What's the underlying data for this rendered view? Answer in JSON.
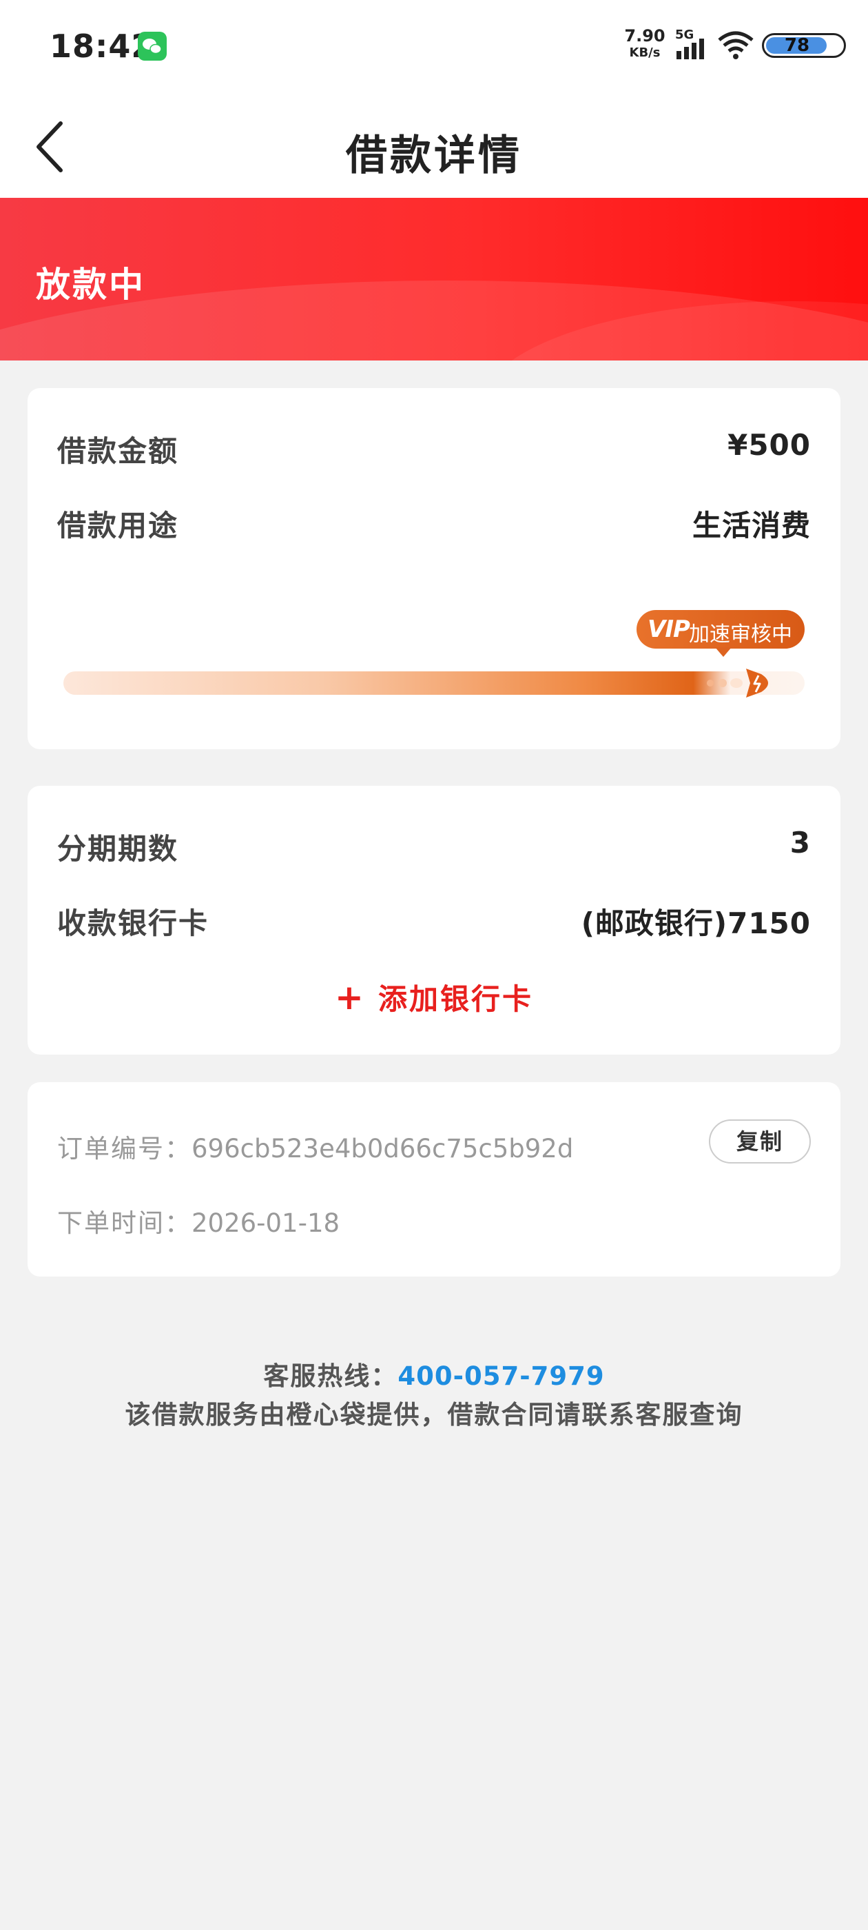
{
  "status_bar": {
    "time": "18:42",
    "net_speed": "7.90",
    "net_speed_unit": "KB/s",
    "network": "5G",
    "battery_level": "78"
  },
  "header": {
    "title": "借款详情"
  },
  "banner": {
    "status": "放款中",
    "color": "#ff2b2b"
  },
  "loan": {
    "amount_label": "借款金额",
    "amount_value": "¥500",
    "purpose_label": "借款用途",
    "purpose_value": "生活消费",
    "vip_badge_vip": "VIP",
    "vip_badge_text": "加速审核中"
  },
  "installments": {
    "periods_label": "分期期数",
    "periods_value": "3",
    "bank_label": "收款银行卡",
    "bank_value": "(邮政银行)7150",
    "add_card_label": "添加银行卡"
  },
  "order": {
    "number_label": "订单编号：",
    "number_value": "696cb523e4b0d66c75c5b92d",
    "copy_label": "复制",
    "time_label": "下单时间：",
    "time_value": "2026-01-18"
  },
  "footer": {
    "hotline_label": "客服热线：",
    "hotline_number": "400-057-7979",
    "notice": "该借款服务由橙心袋提供，借款合同请联系客服查询"
  }
}
